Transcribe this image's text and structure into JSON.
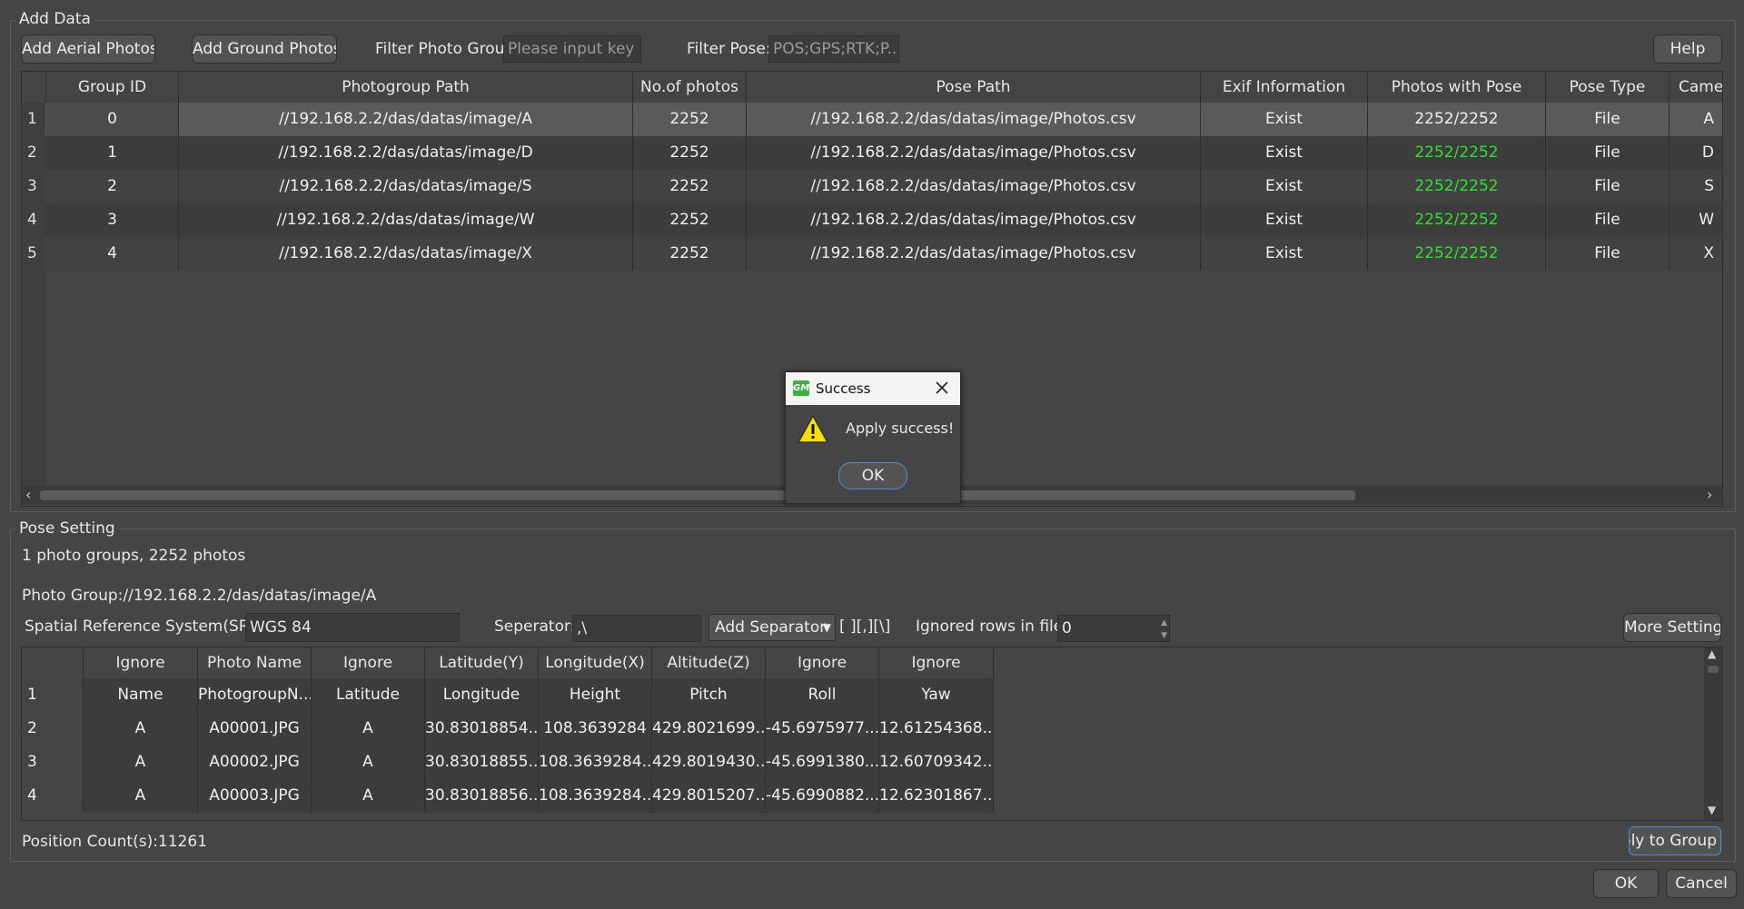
{
  "add_data": {
    "legend": "Add Data",
    "add_aerial": "Add Aerial Photos",
    "add_ground": "Add Ground Photos",
    "filter_group_label": "Filter Photo Group:",
    "filter_group_placeholder": "Please input key ...",
    "filter_pose_label": "Filter Pose:",
    "filter_pose_placeholder": "POS;GPS;RTK;P...",
    "help": "Help",
    "columns": [
      "Group ID",
      "Photogroup Path",
      "No.of photos",
      "Pose Path",
      "Exif Information",
      "Photos with Pose",
      "Pose Type",
      "Camera"
    ],
    "rows": [
      {
        "n": "1",
        "id": "0",
        "path": "//192.168.2.2/das/datas/image/A",
        "count": "2252",
        "pose": "//192.168.2.2/das/datas/image/Photos.csv",
        "exif": "Exist",
        "with_pose": "2252/2252",
        "type": "File",
        "camera": "A"
      },
      {
        "n": "2",
        "id": "1",
        "path": "//192.168.2.2/das/datas/image/D",
        "count": "2252",
        "pose": "//192.168.2.2/das/datas/image/Photos.csv",
        "exif": "Exist",
        "with_pose": "2252/2252",
        "type": "File",
        "camera": "D"
      },
      {
        "n": "3",
        "id": "2",
        "path": "//192.168.2.2/das/datas/image/S",
        "count": "2252",
        "pose": "//192.168.2.2/das/datas/image/Photos.csv",
        "exif": "Exist",
        "with_pose": "2252/2252",
        "type": "File",
        "camera": "S"
      },
      {
        "n": "4",
        "id": "3",
        "path": "//192.168.2.2/das/datas/image/W",
        "count": "2252",
        "pose": "//192.168.2.2/das/datas/image/Photos.csv",
        "exif": "Exist",
        "with_pose": "2252/2252",
        "type": "File",
        "camera": "W"
      },
      {
        "n": "5",
        "id": "4",
        "path": "//192.168.2.2/das/datas/image/X",
        "count": "2252",
        "pose": "//192.168.2.2/das/datas/image/Photos.csv",
        "exif": "Exist",
        "with_pose": "2252/2252",
        "type": "File",
        "camera": "X"
      }
    ]
  },
  "pose_setting": {
    "legend": "Pose Setting",
    "summary": "1 photo groups, 2252 photos",
    "photo_group": "Photo Group://192.168.2.2/das/datas/image/A",
    "srs_label": "Spatial Reference System(SRS)",
    "srs_value": "WGS 84",
    "separator_label": "Seperator:",
    "separator_value": ",\\",
    "add_separator": "Add Separator",
    "separator_options": "[ ][,][\\]",
    "ignored_rows_label": "Ignored rows in file:",
    "ignored_rows_value": "0",
    "more_setting": "More Setting",
    "columns": [
      "Ignore",
      "Photo Name",
      "Ignore",
      "Latitude(Y)",
      "Longitude(X)",
      "Altitude(Z)",
      "Ignore",
      "Ignore"
    ],
    "rows": [
      {
        "n": "1",
        "c": [
          "Name",
          "PhotogroupN...",
          "Latitude",
          "Longitude",
          "Height",
          "Pitch",
          "Roll",
          "Yaw"
        ]
      },
      {
        "n": "2",
        "c": [
          "A",
          "A00001.JPG",
          "A",
          "30.83018854...",
          "108.3639284",
          "429.8021699...",
          "-45.6975977...",
          "12.61254368..."
        ]
      },
      {
        "n": "3",
        "c": [
          "A",
          "A00002.JPG",
          "A",
          "30.83018855...",
          "108.3639284...",
          "429.8019430...",
          "-45.6991380...",
          "12.60709342..."
        ]
      },
      {
        "n": "4",
        "c": [
          "A",
          "A00003.JPG",
          "A",
          "30.83018856...",
          "108.3639284...",
          "429.8015207...",
          "-45.6990882...",
          "12.62301867..."
        ]
      }
    ],
    "position_count": "Position Count(s):11261",
    "apply_to_group": "Apply to Group"
  },
  "footer": {
    "ok": "OK",
    "cancel": "Cancel"
  },
  "dialog": {
    "title": "Success",
    "app_icon_text": "GM",
    "message": "Apply success!",
    "ok": "OK"
  },
  "colors": {
    "ok_green": "#2fe02f",
    "background": "#454545",
    "dialog_title_bg": "#f4f4f4",
    "accent_blue": "#4a90d9"
  }
}
